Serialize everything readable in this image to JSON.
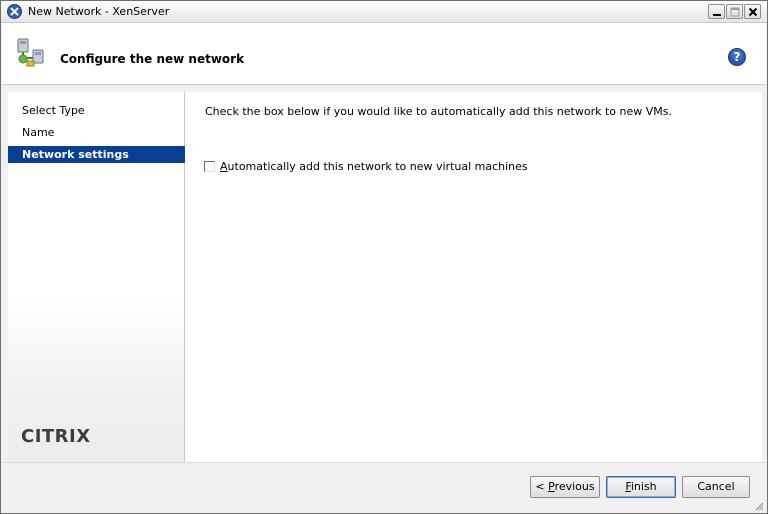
{
  "window": {
    "title": "New Network - XenServer",
    "controls": [
      "minimize",
      "maximize",
      "close"
    ]
  },
  "header": {
    "title": "Configure the new network",
    "icon": "network-wizard-icon",
    "help_icon": "help-icon"
  },
  "sidebar": {
    "steps": [
      {
        "label": "Select Type",
        "active": false
      },
      {
        "label": "Name",
        "active": false
      },
      {
        "label": "Network settings",
        "active": true
      }
    ],
    "logo_text": "CITRIX"
  },
  "content": {
    "instruction": "Check the box below if you would like to automatically add this network to new VMs.",
    "checkbox": {
      "label_mnemonic": "A",
      "label_rest": "utomatically add this network to new virtual machines",
      "checked": false
    }
  },
  "footer": {
    "previous": {
      "prefix": "< ",
      "mnemonic": "P",
      "rest": "revious"
    },
    "finish": {
      "mnemonic": "F",
      "rest": "inish"
    },
    "cancel": "Cancel"
  },
  "colors": {
    "active_step": "#0a3f97",
    "window_background": "#f0f0f0",
    "panel_background": "#ffffff"
  }
}
